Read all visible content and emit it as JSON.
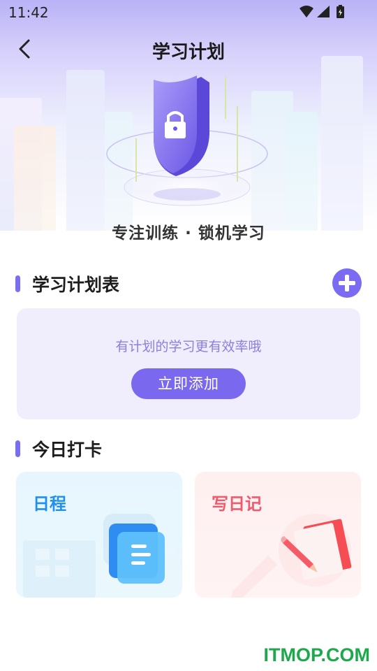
{
  "status_bar": {
    "time": "11:42",
    "icons": [
      "wifi-icon",
      "cellular-signal-icon",
      "battery-charging-icon"
    ]
  },
  "header": {
    "title": "学习计划",
    "back_icon": "back-arrow-icon"
  },
  "hero": {
    "caption": "专注训练 · 锁机学习",
    "illustration": "shield-lock-icon"
  },
  "plan_section": {
    "title": "学习计划表",
    "add_icon": "plus-circle-icon",
    "empty_hint": "有计划的学习更有效率哦",
    "add_button": "立即添加"
  },
  "checkin_section": {
    "title": "今日打卡",
    "cards": [
      {
        "label": "日程",
        "icon": "schedule-document-icon"
      },
      {
        "label": "写日记",
        "icon": "diary-pencil-icon"
      }
    ]
  },
  "watermark": "ITMOP.COM",
  "colors": {
    "accent": "#7a68ef",
    "schedule": "#1f8ff0",
    "diary": "#ef5b6b",
    "watermark": "#1ea84c"
  }
}
